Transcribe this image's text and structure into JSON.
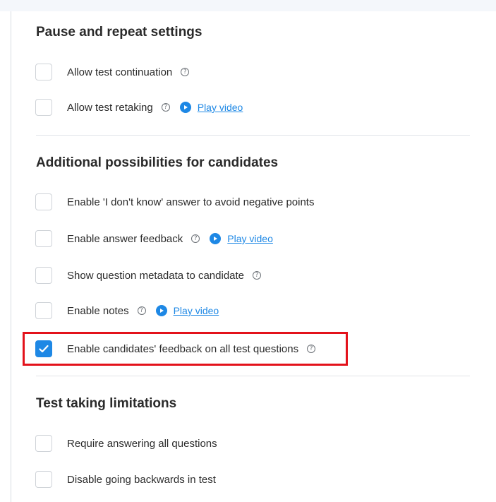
{
  "sections": [
    {
      "title": "Pause and repeat settings",
      "items": [
        {
          "label": "Allow test continuation",
          "checked": false,
          "help": true
        },
        {
          "label": "Allow test retaking",
          "checked": false,
          "help": true,
          "video": "Play video"
        }
      ]
    },
    {
      "title": "Additional possibilities for candidates",
      "items": [
        {
          "label": "Enable 'I don't know' answer to avoid negative points",
          "checked": false
        },
        {
          "label": "Enable answer feedback",
          "checked": false,
          "help": true,
          "video": "Play video"
        },
        {
          "label": "Show question metadata to candidate",
          "checked": false,
          "help": true
        },
        {
          "label": "Enable notes",
          "checked": false,
          "help": true,
          "video": "Play video"
        },
        {
          "label": "Enable candidates' feedback on all test questions",
          "checked": true,
          "help": true,
          "highlighted": true
        }
      ]
    },
    {
      "title": "Test taking limitations",
      "items": [
        {
          "label": "Require answering all questions",
          "checked": false
        },
        {
          "label": "Disable going backwards in test",
          "checked": false
        }
      ]
    }
  ],
  "help_glyph": "?",
  "colors": {
    "accent": "#1e88e5",
    "highlight": "#e3121b",
    "checkbox_border": "#cfd3d8",
    "divider": "#e1e4e8"
  },
  "icons": {
    "help": "question-circle-icon",
    "video": "play-circle-icon",
    "check": "checkmark-icon"
  }
}
